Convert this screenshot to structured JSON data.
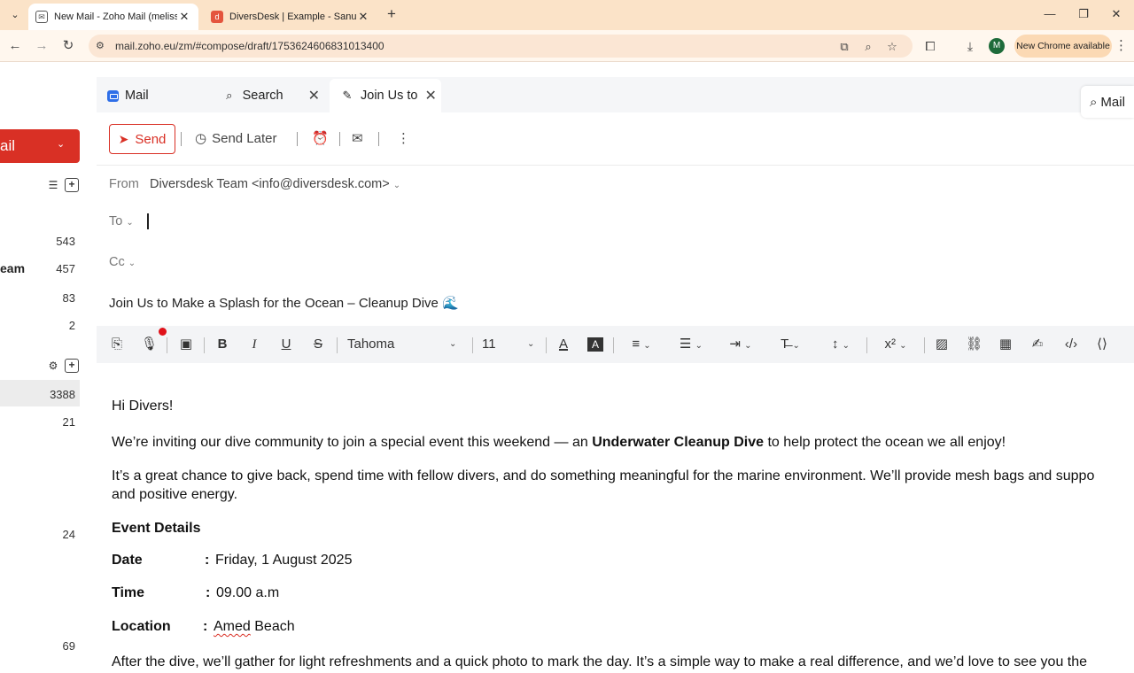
{
  "browser": {
    "tabs": [
      {
        "title": "New Mail - Zoho Mail (melissa",
        "close": "✕"
      },
      {
        "title": "DiversDesk | Example - Sanur",
        "close": "✕"
      }
    ],
    "new_tab": "+",
    "url": "mail.zoho.eu/zm/#compose/draft/1753624606831013400",
    "profile_initial": "M",
    "update_label": "New Chrome available",
    "accent": "#fbe3c8"
  },
  "sidebar": {
    "new_mail_label": "ail",
    "counts": [
      {
        "value": "543"
      },
      {
        "label": "eam",
        "value": "457"
      },
      {
        "value": "83"
      },
      {
        "value": "2"
      },
      {
        "value": "3388"
      },
      {
        "value": "21"
      },
      {
        "value": "24"
      },
      {
        "value": "69"
      }
    ]
  },
  "zoho_tabs": [
    {
      "label": "Mail",
      "icon": "mail-icon"
    },
    {
      "label": "Search",
      "icon": "search-icon",
      "close": "✕"
    },
    {
      "label": "Join Us to",
      "icon": "pencil-icon",
      "close": "✕"
    }
  ],
  "global_search_label": "Mail",
  "toolbar": {
    "send_label": "Send",
    "send_later_label": "Send Later"
  },
  "compose": {
    "from_label": "From",
    "from_value": "Diversdesk Team <info@diversdesk.com>",
    "to_label": "To",
    "cc_label": "Cc",
    "subject": "Join Us to Make a Splash for the Ocean – Cleanup Dive 🌊"
  },
  "format": {
    "font_name": "Tahoma",
    "font_size": "11"
  },
  "body": {
    "greeting": "Hi Divers!",
    "p1_before": "We’re inviting our dive community to join a special event this weekend — an ",
    "p1_bold": "Underwater Cleanup Dive",
    "p1_after": " to help protect the ocean we all enjoy!",
    "p2_line1": "It’s a great chance to give back, spend time with fellow divers, and do something meaningful for the marine environment. We’ll provide mesh bags and suppo",
    "p2_line2": "and positive energy.",
    "details_heading": "Event Details",
    "rows": [
      {
        "label": "Date",
        "value": "Friday, 1 August 2025"
      },
      {
        "label": "Time",
        "value": "09.00 a.m"
      },
      {
        "label": "Location",
        "value_prefix": "Amed",
        "value_suffix": " Beach"
      }
    ],
    "colon": ":",
    "p3": "After the dive, we’ll gather for light refreshments and a quick photo to mark the day. It’s a simple way to make a real difference, and we’d love to see you the"
  }
}
